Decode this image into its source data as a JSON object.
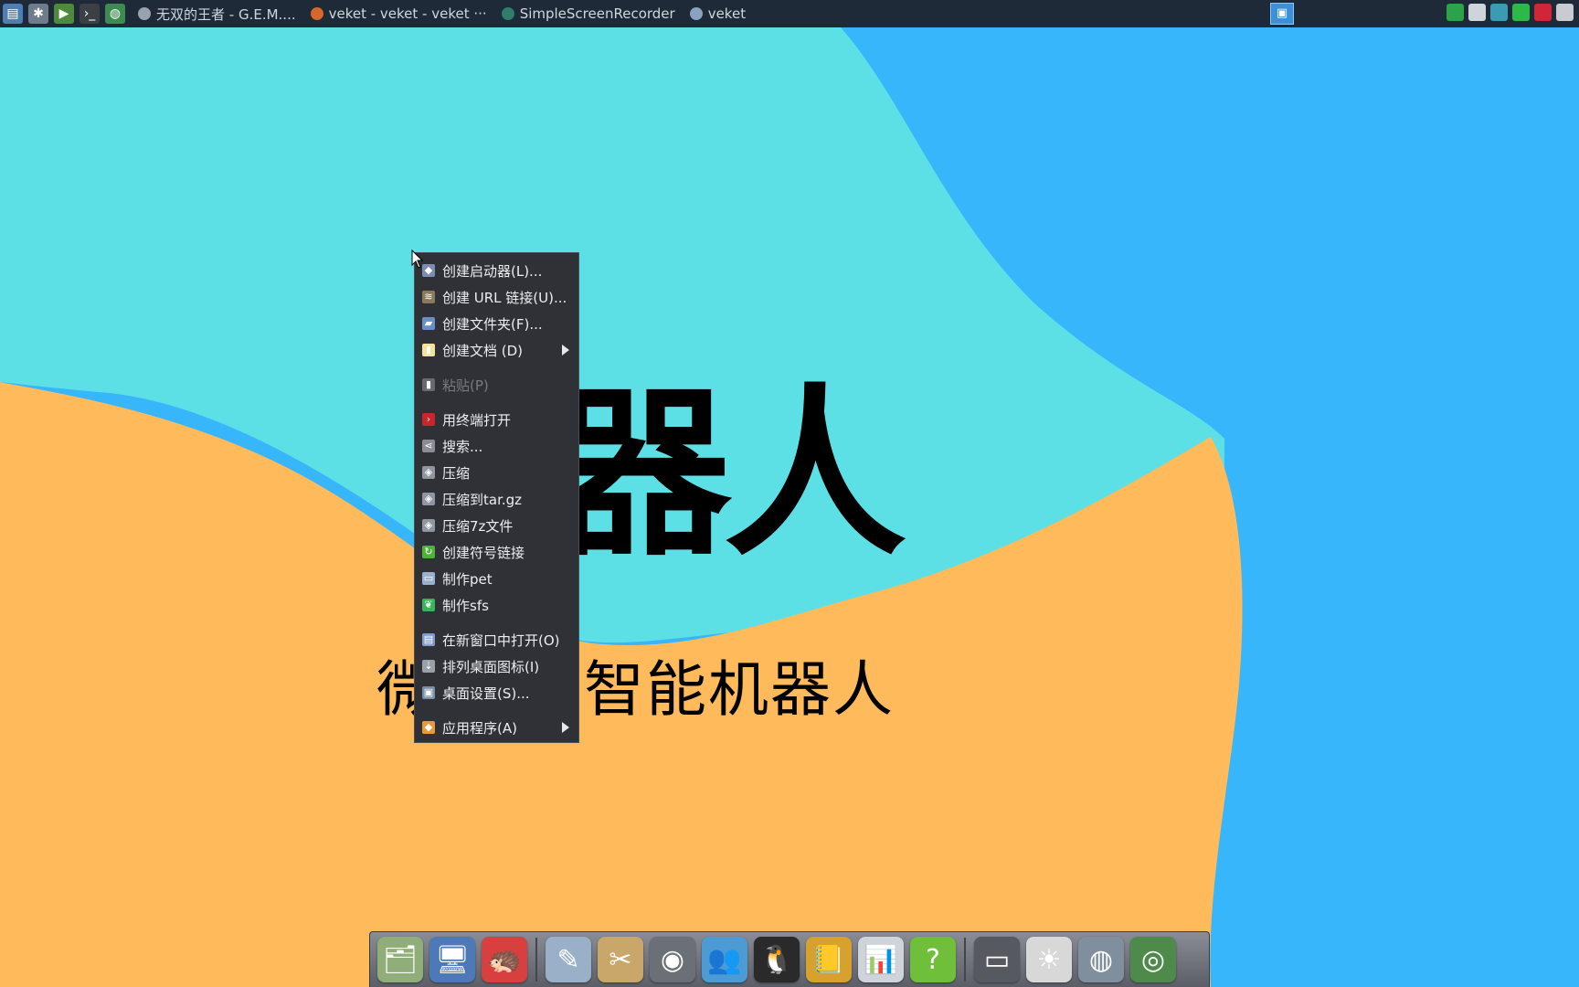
{
  "taskbar": {
    "launchers": [
      {
        "name": "system-monitor-icon",
        "glyph": "▤",
        "color": "#4d7fb5"
      },
      {
        "name": "settings-tools-icon",
        "glyph": "✱",
        "color": "#6f7c8c"
      },
      {
        "name": "run-icon",
        "glyph": "▶",
        "color": "#4e8a3c"
      },
      {
        "name": "terminal-icon",
        "glyph": "›_",
        "color": "#3c3f44"
      },
      {
        "name": "browser-globe-icon",
        "glyph": "◍",
        "color": "#3d8b50"
      }
    ],
    "tasks": [
      {
        "label": "无双的王者 - G.E.M....",
        "icon_color": "#9aa3ad"
      },
      {
        "label": "veket - veket - veket ···",
        "icon_color": "#d7672a"
      },
      {
        "label": "SimpleScreenRecorder",
        "icon_color": "#2f7d6a"
      },
      {
        "label": "veket",
        "icon_color": "#8aa2bd"
      }
    ],
    "tray": [
      {
        "name": "shield-icon",
        "color": "#2aa34a"
      },
      {
        "name": "clipboard-icon",
        "color": "#cfd4da"
      },
      {
        "name": "network-icon",
        "color": "#3a9bb5"
      },
      {
        "name": "battery-icon",
        "color": "#2db84a"
      },
      {
        "name": "record-icon",
        "color": "#d0263a"
      },
      {
        "name": "keyboard-icon",
        "color": "#c8ccd1"
      }
    ]
  },
  "wallpaper": {
    "big_text": "器人",
    "sub_text": "微 人工智能机器人",
    "colors": {
      "cyan": "#5ce0e6",
      "blue": "#38b6fc",
      "orange": "#ffba5b"
    }
  },
  "context_menu": {
    "items": [
      {
        "label": "创建启动器(L)...",
        "icon": "launcher-icon",
        "icon_color": "#7b8db0",
        "glyph": "◆"
      },
      {
        "label": "创建 URL 链接(U)...",
        "icon": "url-link-icon",
        "icon_color": "#8a7a5a",
        "glyph": "≋"
      },
      {
        "label": "创建文件夹(F)...",
        "icon": "folder-icon",
        "icon_color": "#6a8fc7",
        "glyph": "▰"
      },
      {
        "label": "创建文档 (D)",
        "icon": "document-icon",
        "icon_color": "#f4e39a",
        "glyph": "▮",
        "submenu": true
      },
      {
        "separator": true
      },
      {
        "label": "粘贴(P)",
        "icon": "paste-icon",
        "icon_color": "#666a70",
        "glyph": "▮",
        "disabled": true
      },
      {
        "separator": true
      },
      {
        "label": "用终端打开",
        "icon": "terminal-icon",
        "icon_color": "#c9252b",
        "glyph": "›"
      },
      {
        "label": "搜索...",
        "icon": "search-share-icon",
        "icon_color": "#8a8d93",
        "glyph": "⋖"
      },
      {
        "label": "压缩",
        "icon": "compress-icon",
        "icon_color": "#8f96a0",
        "glyph": "◈"
      },
      {
        "label": "压缩到tar.gz",
        "icon": "compress-targz-icon",
        "icon_color": "#8f96a0",
        "glyph": "◈"
      },
      {
        "label": "压缩7z文件",
        "icon": "compress-7z-icon",
        "icon_color": "#8f96a0",
        "glyph": "◈"
      },
      {
        "label": "创建符号链接",
        "icon": "symlink-icon",
        "icon_color": "#4fb03a",
        "glyph": "↻"
      },
      {
        "label": "制作pet",
        "icon": "make-pet-icon",
        "icon_color": "#9bb0cc",
        "glyph": "▭"
      },
      {
        "label": "制作sfs",
        "icon": "make-sfs-icon",
        "icon_color": "#39b45a",
        "glyph": "❦"
      },
      {
        "separator": true
      },
      {
        "label": "在新窗口中打开(O)",
        "icon": "new-window-icon",
        "icon_color": "#7d9cc9",
        "glyph": "▤"
      },
      {
        "label": "排列桌面图标(I)",
        "icon": "arrange-icons-icon",
        "icon_color": "#9aa0a8",
        "glyph": "⇣"
      },
      {
        "label": "桌面设置(S)...",
        "icon": "desktop-settings-icon",
        "icon_color": "#7a8ea6",
        "glyph": "▣"
      },
      {
        "separator": true
      },
      {
        "label": "应用程序(A)",
        "icon": "applications-icon",
        "icon_color": "#e8993a",
        "glyph": "◆",
        "submenu": true
      }
    ]
  },
  "dock": {
    "items": [
      {
        "name": "file-manager-icon",
        "glyph": "🗂",
        "color": "#8fae7a"
      },
      {
        "name": "monitor-icon",
        "glyph": "🖥",
        "color": "#4e79b8"
      },
      {
        "name": "mascot-icon",
        "glyph": "🦔",
        "color": "#d84040"
      },
      {
        "divider": true
      },
      {
        "name": "text-editor-icon",
        "glyph": "✎",
        "color": "#9ab0c8"
      },
      {
        "name": "paint-tools-icon",
        "glyph": "✂",
        "color": "#c9a76a"
      },
      {
        "name": "media-player-icon",
        "glyph": "◉",
        "color": "#6b6f76"
      },
      {
        "name": "users-icon",
        "glyph": "👥",
        "color": "#4d9bd4"
      },
      {
        "name": "qq-penguin-icon",
        "glyph": "🐧",
        "color": "#2a2a2a"
      },
      {
        "name": "address-book-icon",
        "glyph": "📒",
        "color": "#d6a12c"
      },
      {
        "name": "spreadsheet-icon",
        "glyph": "📊",
        "color": "#cfd4da"
      },
      {
        "name": "help-icon",
        "glyph": "?",
        "color": "#6fbf3a"
      },
      {
        "divider": true
      },
      {
        "name": "scanner-icon",
        "glyph": "▭",
        "color": "#565a60"
      },
      {
        "name": "brightness-icon",
        "glyph": "☀",
        "color": "#d8d8d8"
      },
      {
        "name": "globe-icon",
        "glyph": "◍",
        "color": "#7f8f9e"
      },
      {
        "name": "camera-lens-icon",
        "glyph": "◎",
        "color": "#4e8a4a"
      }
    ]
  }
}
